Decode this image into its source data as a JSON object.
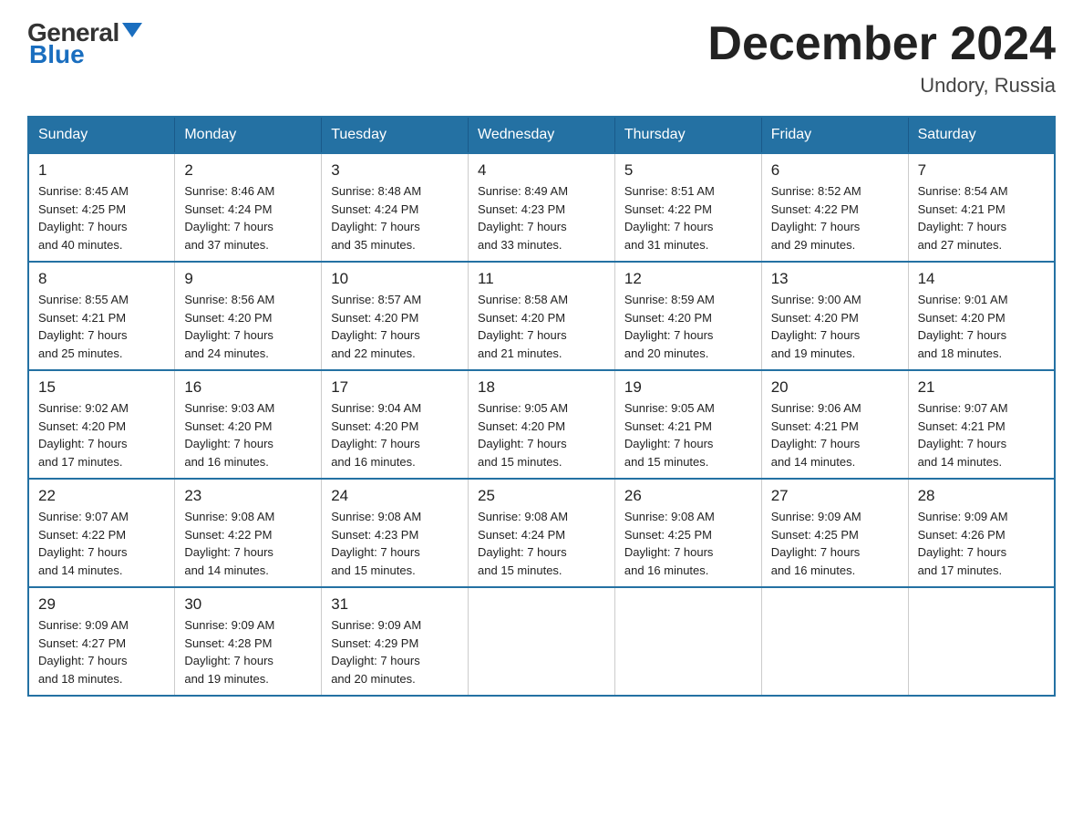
{
  "logo": {
    "general": "General",
    "blue": "Blue",
    "triangle": true
  },
  "title": {
    "month_year": "December 2024",
    "location": "Undory, Russia"
  },
  "headers": [
    "Sunday",
    "Monday",
    "Tuesday",
    "Wednesday",
    "Thursday",
    "Friday",
    "Saturday"
  ],
  "weeks": [
    [
      {
        "day": "1",
        "info": "Sunrise: 8:45 AM\nSunset: 4:25 PM\nDaylight: 7 hours\nand 40 minutes."
      },
      {
        "day": "2",
        "info": "Sunrise: 8:46 AM\nSunset: 4:24 PM\nDaylight: 7 hours\nand 37 minutes."
      },
      {
        "day": "3",
        "info": "Sunrise: 8:48 AM\nSunset: 4:24 PM\nDaylight: 7 hours\nand 35 minutes."
      },
      {
        "day": "4",
        "info": "Sunrise: 8:49 AM\nSunset: 4:23 PM\nDaylight: 7 hours\nand 33 minutes."
      },
      {
        "day": "5",
        "info": "Sunrise: 8:51 AM\nSunset: 4:22 PM\nDaylight: 7 hours\nand 31 minutes."
      },
      {
        "day": "6",
        "info": "Sunrise: 8:52 AM\nSunset: 4:22 PM\nDaylight: 7 hours\nand 29 minutes."
      },
      {
        "day": "7",
        "info": "Sunrise: 8:54 AM\nSunset: 4:21 PM\nDaylight: 7 hours\nand 27 minutes."
      }
    ],
    [
      {
        "day": "8",
        "info": "Sunrise: 8:55 AM\nSunset: 4:21 PM\nDaylight: 7 hours\nand 25 minutes."
      },
      {
        "day": "9",
        "info": "Sunrise: 8:56 AM\nSunset: 4:20 PM\nDaylight: 7 hours\nand 24 minutes."
      },
      {
        "day": "10",
        "info": "Sunrise: 8:57 AM\nSunset: 4:20 PM\nDaylight: 7 hours\nand 22 minutes."
      },
      {
        "day": "11",
        "info": "Sunrise: 8:58 AM\nSunset: 4:20 PM\nDaylight: 7 hours\nand 21 minutes."
      },
      {
        "day": "12",
        "info": "Sunrise: 8:59 AM\nSunset: 4:20 PM\nDaylight: 7 hours\nand 20 minutes."
      },
      {
        "day": "13",
        "info": "Sunrise: 9:00 AM\nSunset: 4:20 PM\nDaylight: 7 hours\nand 19 minutes."
      },
      {
        "day": "14",
        "info": "Sunrise: 9:01 AM\nSunset: 4:20 PM\nDaylight: 7 hours\nand 18 minutes."
      }
    ],
    [
      {
        "day": "15",
        "info": "Sunrise: 9:02 AM\nSunset: 4:20 PM\nDaylight: 7 hours\nand 17 minutes."
      },
      {
        "day": "16",
        "info": "Sunrise: 9:03 AM\nSunset: 4:20 PM\nDaylight: 7 hours\nand 16 minutes."
      },
      {
        "day": "17",
        "info": "Sunrise: 9:04 AM\nSunset: 4:20 PM\nDaylight: 7 hours\nand 16 minutes."
      },
      {
        "day": "18",
        "info": "Sunrise: 9:05 AM\nSunset: 4:20 PM\nDaylight: 7 hours\nand 15 minutes."
      },
      {
        "day": "19",
        "info": "Sunrise: 9:05 AM\nSunset: 4:21 PM\nDaylight: 7 hours\nand 15 minutes."
      },
      {
        "day": "20",
        "info": "Sunrise: 9:06 AM\nSunset: 4:21 PM\nDaylight: 7 hours\nand 14 minutes."
      },
      {
        "day": "21",
        "info": "Sunrise: 9:07 AM\nSunset: 4:21 PM\nDaylight: 7 hours\nand 14 minutes."
      }
    ],
    [
      {
        "day": "22",
        "info": "Sunrise: 9:07 AM\nSunset: 4:22 PM\nDaylight: 7 hours\nand 14 minutes."
      },
      {
        "day": "23",
        "info": "Sunrise: 9:08 AM\nSunset: 4:22 PM\nDaylight: 7 hours\nand 14 minutes."
      },
      {
        "day": "24",
        "info": "Sunrise: 9:08 AM\nSunset: 4:23 PM\nDaylight: 7 hours\nand 15 minutes."
      },
      {
        "day": "25",
        "info": "Sunrise: 9:08 AM\nSunset: 4:24 PM\nDaylight: 7 hours\nand 15 minutes."
      },
      {
        "day": "26",
        "info": "Sunrise: 9:08 AM\nSunset: 4:25 PM\nDaylight: 7 hours\nand 16 minutes."
      },
      {
        "day": "27",
        "info": "Sunrise: 9:09 AM\nSunset: 4:25 PM\nDaylight: 7 hours\nand 16 minutes."
      },
      {
        "day": "28",
        "info": "Sunrise: 9:09 AM\nSunset: 4:26 PM\nDaylight: 7 hours\nand 17 minutes."
      }
    ],
    [
      {
        "day": "29",
        "info": "Sunrise: 9:09 AM\nSunset: 4:27 PM\nDaylight: 7 hours\nand 18 minutes."
      },
      {
        "day": "30",
        "info": "Sunrise: 9:09 AM\nSunset: 4:28 PM\nDaylight: 7 hours\nand 19 minutes."
      },
      {
        "day": "31",
        "info": "Sunrise: 9:09 AM\nSunset: 4:29 PM\nDaylight: 7 hours\nand 20 minutes."
      },
      null,
      null,
      null,
      null
    ]
  ]
}
